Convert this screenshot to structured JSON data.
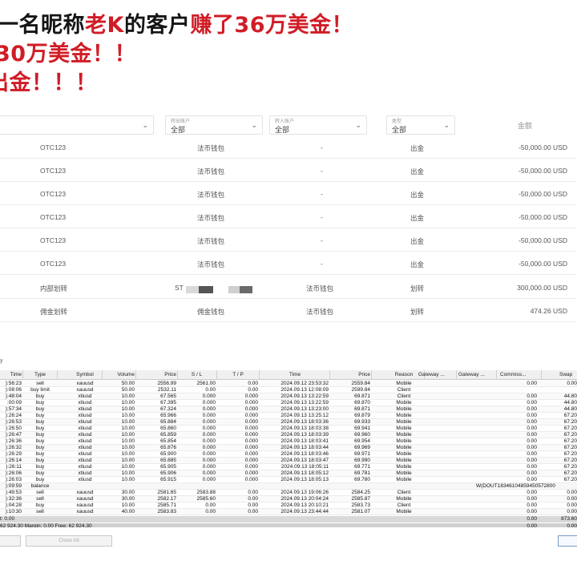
{
  "headline": {
    "line1": [
      {
        "t": "一名昵称",
        "red": false
      },
      {
        "t": "老K",
        "red": true
      },
      {
        "t": "的客户",
        "red": false
      },
      {
        "t": "赚了36万美金！",
        "red": true
      }
    ],
    "line2": [
      {
        "t": "30万美金！！",
        "red": true
      }
    ],
    "line3": [
      {
        "t": "出金！！！",
        "red": true
      }
    ]
  },
  "filters": {
    "out_account": {
      "label": "转出账户",
      "value": "全部"
    },
    "in_account": {
      "label": "转入账户",
      "value": "全部"
    },
    "type": {
      "label": "类型",
      "value": "全部"
    },
    "amount_header": "金额"
  },
  "transactions": [
    {
      "name": "OTC123",
      "from": "法币钱包",
      "to": "-",
      "type": "出金",
      "amount": "-50,000.00 USD"
    },
    {
      "name": "OTC123",
      "from": "法币钱包",
      "to": "-",
      "type": "出金",
      "amount": "-50,000.00 USD"
    },
    {
      "name": "OTC123",
      "from": "法币钱包",
      "to": "-",
      "type": "出金",
      "amount": "-50,000.00 USD"
    },
    {
      "name": "OTC123",
      "from": "法币钱包",
      "to": "-",
      "type": "出金",
      "amount": "-50,000.00 USD"
    },
    {
      "name": "OTC123",
      "from": "法币钱包",
      "to": "-",
      "type": "出金",
      "amount": "-50,000.00 USD"
    },
    {
      "name": "OTC123",
      "from": "法币钱包",
      "to": "-",
      "type": "出金",
      "amount": "-50,000.00 USD"
    },
    {
      "name": "内部划转",
      "from": "ST",
      "to": "法币钱包",
      "type": "划转",
      "amount": "300,000.00 USD"
    },
    {
      "name": "佣金划转",
      "from": "佣金钱包",
      "to": "法币钱包",
      "type": "划转",
      "amount": "474.26 USD"
    }
  ],
  "terminal": {
    "label": "y",
    "headers": [
      "Time",
      "Type",
      "Symbol",
      "Volume",
      "Price",
      "S / L",
      "T / P",
      "Time",
      "Price",
      "Reason",
      "Gateway ...",
      "Gateway ...",
      "Commiss...",
      "Swap"
    ],
    "rows": [
      [
        "):56:23",
        "sell",
        "xauusd",
        "50.00",
        "2556.99",
        "2561.00",
        "0.00",
        "2024.09.12 23:53:32",
        "2559.84",
        "Mobile",
        "0.00",
        "0.00"
      ],
      [
        "):08:06",
        "buy limit",
        "xauusd",
        "50.00",
        "2532.11",
        "0.00",
        "0.00",
        "2024.09.13 12:08:09",
        "2599.84",
        "Client",
        "",
        ""
      ],
      [
        "):48:04",
        "buy",
        "xtiusd",
        "10.00",
        "67.565",
        "0.000",
        "0.000",
        "2024.09.13 13:22:59",
        "69.871",
        "Client",
        "0.00",
        "44.80"
      ],
      [
        ":00:09",
        "buy",
        "xtiusd",
        "10.00",
        "67.395",
        "0.000",
        "0.000",
        "2024.09.13 13:22:59",
        "69.870",
        "Mobile",
        "0.00",
        "44.80"
      ],
      [
        "):57:34",
        "buy",
        "xtiusd",
        "10.00",
        "67.324",
        "0.000",
        "0.000",
        "2024.09.13 13:23:00",
        "69.871",
        "Mobile",
        "0.00",
        "44.80"
      ],
      [
        "):26:24",
        "buy",
        "xtiusd",
        "10.00",
        "65.966",
        "0.000",
        "0.000",
        "2024.09.13 13:25:12",
        "69.879",
        "Mobile",
        "0.00",
        "67.20"
      ],
      [
        "):26:53",
        "buy",
        "xtiusd",
        "10.00",
        "65.884",
        "0.000",
        "0.000",
        "2024.09.13 18:03:36",
        "69.933",
        "Mobile",
        "0.00",
        "67.20"
      ],
      [
        "):26:50",
        "buy",
        "xtiusd",
        "10.00",
        "65.860",
        "0.000",
        "0.000",
        "2024.09.13 18:03:38",
        "69.941",
        "Mobile",
        "0.00",
        "67.20"
      ],
      [
        "):26:47",
        "buy",
        "xtiusd",
        "10.00",
        "65.859",
        "0.000",
        "0.000",
        "2024.09.13 18:03:39",
        "69.960",
        "Mobile",
        "0.00",
        "67.20"
      ],
      [
        "):26:36",
        "buy",
        "xtiusd",
        "10.00",
        "65.854",
        "0.000",
        "0.000",
        "2024.09.13 18:03:41",
        "69.954",
        "Mobile",
        "0.00",
        "67.20"
      ],
      [
        "):26:32",
        "buy",
        "xtiusd",
        "10.00",
        "65.876",
        "0.000",
        "0.000",
        "2024.09.13 18:03:44",
        "69.969",
        "Mobile",
        "0.00",
        "67.20"
      ],
      [
        "):26:29",
        "buy",
        "xtiusd",
        "10.00",
        "65.900",
        "0.000",
        "0.000",
        "2024.09.13 18:03:46",
        "69.971",
        "Mobile",
        "0.00",
        "67.20"
      ],
      [
        "):26:14",
        "buy",
        "xtiusd",
        "10.00",
        "65.885",
        "0.000",
        "0.000",
        "2024.09.13 18:03:47",
        "69.990",
        "Mobile",
        "0.00",
        "67.20"
      ],
      [
        "):26:11",
        "buy",
        "xtiusd",
        "10.00",
        "65.905",
        "0.000",
        "0.000",
        "2024.09.13 18:05:11",
        "69.771",
        "Mobile",
        "0.00",
        "67.20"
      ],
      [
        "):26:06",
        "buy",
        "xtiusd",
        "10.00",
        "65.906",
        "0.000",
        "0.000",
        "2024.09.13 18:05:12",
        "69.781",
        "Mobile",
        "0.00",
        "67.20"
      ],
      [
        "):26:03",
        "buy",
        "xtiusd",
        "10.00",
        "65.915",
        "0.000",
        "0.000",
        "2024.09.13 18:05:13",
        "69.780",
        "Mobile",
        "0.00",
        "67.20"
      ],
      [
        "):09:59",
        "balance",
        "",
        "",
        "",
        "",
        "",
        "",
        "",
        "",
        "",
        ""
      ],
      [
        "):49:53",
        "sell",
        "xauusd",
        "30.00",
        "2581.65",
        "2583.88",
        "0.00",
        "2024.09.13 19:06:26",
        "2584.25",
        "Client",
        "0.00",
        "0.00"
      ],
      [
        "):32:36",
        "sell",
        "xauusd",
        "30.00",
        "2582.17",
        "2585.60",
        "0.00",
        "2024.09.13 20:04:24",
        "2585.87",
        "Mobile",
        "0.00",
        "0.00"
      ],
      [
        "):04:28",
        "buy",
        "xauusd",
        "10.00",
        "2585.71",
        "0.00",
        "0.00",
        "2024.09.13 20:10:21",
        "2583.73",
        "Client",
        "0.00",
        "0.00"
      ],
      [
        "):10:30",
        "sell",
        "xauusd",
        "40.00",
        "2583.83",
        "0.00",
        "0.00",
        "2024.09.13 23:44:44",
        "2581.07",
        "Mobile",
        "0.00",
        "0.00"
      ]
    ],
    "balance_comment": "W(DOUT18346104859450572800",
    "total_left": "t: 0.00",
    "total_comm": "0.00",
    "total_swap": "873.60",
    "free_line": "62 924.30   Margin: 0.00   Free: 62 924.30"
  },
  "bottom": {
    "close_all": "Close All"
  }
}
